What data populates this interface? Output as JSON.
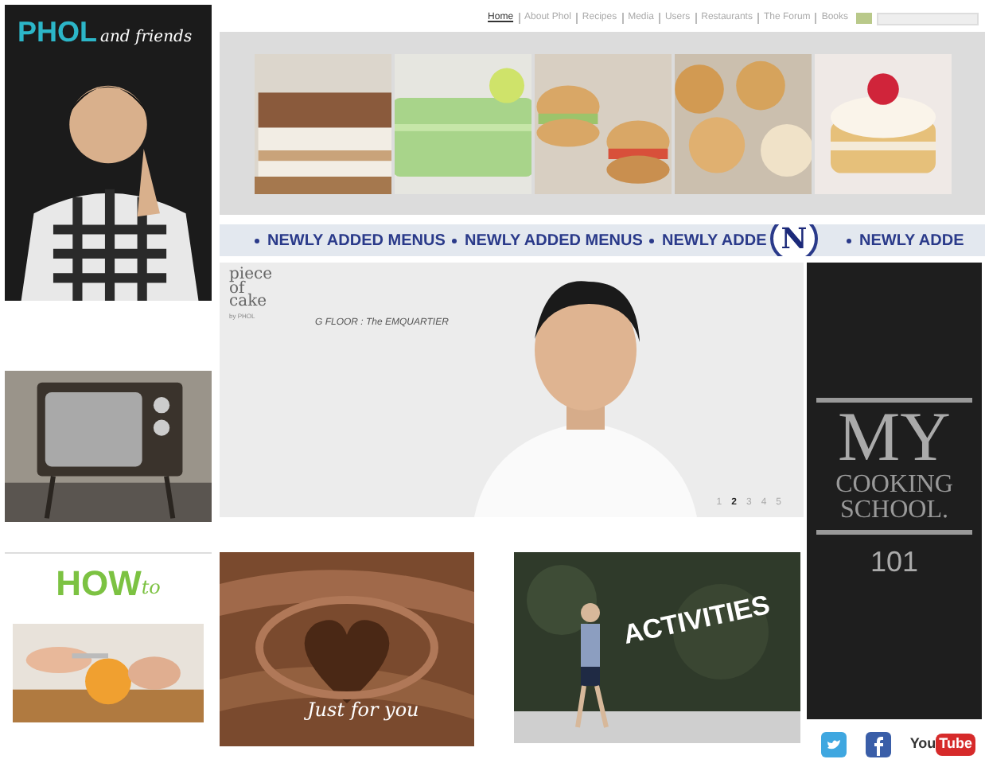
{
  "nav": {
    "items": [
      {
        "label": "Home",
        "selected": true
      },
      {
        "label": "About Phol",
        "selected": false
      },
      {
        "label": "Recipes",
        "selected": false
      },
      {
        "label": "Media",
        "selected": false
      },
      {
        "label": "Users",
        "selected": false
      },
      {
        "label": "Restaurants",
        "selected": false
      },
      {
        "label": "The Forum",
        "selected": false
      },
      {
        "label": "Books",
        "selected": false
      }
    ]
  },
  "profile": {
    "logo": "PHOL",
    "logo_script": "and friends"
  },
  "ticker": {
    "items": [
      "NEWLY ADDED MENUS",
      "NEWLY ADDED MENUS",
      "NEWLY ADDE",
      "NEWLY ADDE"
    ],
    "badge": "N"
  },
  "hero": {
    "logo": [
      "piece",
      "of",
      "cake"
    ],
    "logo_by": "by PHOL",
    "location": "G FLOOR : The EMQUARTIER",
    "pager": [
      {
        "label": "1",
        "selected": false
      },
      {
        "label": "2",
        "selected": true
      },
      {
        "label": "3",
        "selected": false
      },
      {
        "label": "4",
        "selected": false
      },
      {
        "label": "5",
        "selected": false
      }
    ]
  },
  "school": {
    "title": "MY",
    "lines": [
      "COOKING",
      "SCHOOL."
    ],
    "number": "101"
  },
  "howto": {
    "title": "HOW",
    "script": "to"
  },
  "chocolate": {
    "script": "Just for you"
  },
  "activities": {
    "title": "ACTIVITIES"
  },
  "social": [
    {
      "kind": "twitter"
    },
    {
      "kind": "facebook"
    },
    {
      "kind": "youtube",
      "label": "You Tube"
    }
  ]
}
